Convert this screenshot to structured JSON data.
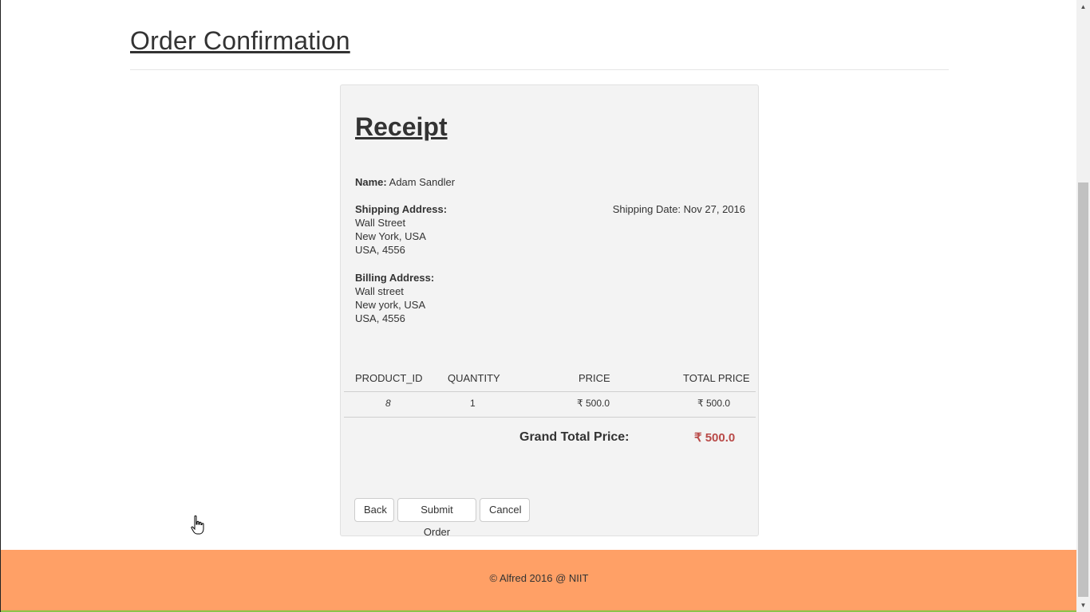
{
  "page": {
    "title": "Order Confirmation"
  },
  "receipt": {
    "title": "Receipt",
    "name_label": "Name:",
    "name_value": "Adam Sandler",
    "shipping_label": "Shipping Address:",
    "shipping_lines": [
      "Wall Street",
      "New York, USA",
      "USA, 4556"
    ],
    "shipping_date_label": "Shipping Date:",
    "shipping_date_value": "Nov 27, 2016",
    "billing_label": "Billing Address:",
    "billing_lines": [
      "Wall street",
      "New york, USA",
      "USA, 4556"
    ]
  },
  "table": {
    "headers": [
      "PRODUCT_ID",
      "QUANTITY",
      "PRICE",
      "TOTAL PRICE"
    ],
    "rows": [
      {
        "product_id": "8",
        "quantity": "1",
        "price": "₹ 500.0",
        "total_price": "₹ 500.0"
      }
    ]
  },
  "totals": {
    "grand_total_label": "Grand Total Price:",
    "grand_total_value": "₹ 500.0",
    "grand_total_color": "#b94a48"
  },
  "actions": {
    "back_label": "Back",
    "submit_label": "Submit Order",
    "cancel_label": "Cancel"
  },
  "footer": {
    "text": "© Alfred 2016 @ NIIT",
    "background_color": "#ffa066"
  },
  "icons": {
    "scroll_up": "chevron-up-icon",
    "scroll_down": "chevron-down-icon",
    "cursor": "hand-pointer-icon"
  }
}
